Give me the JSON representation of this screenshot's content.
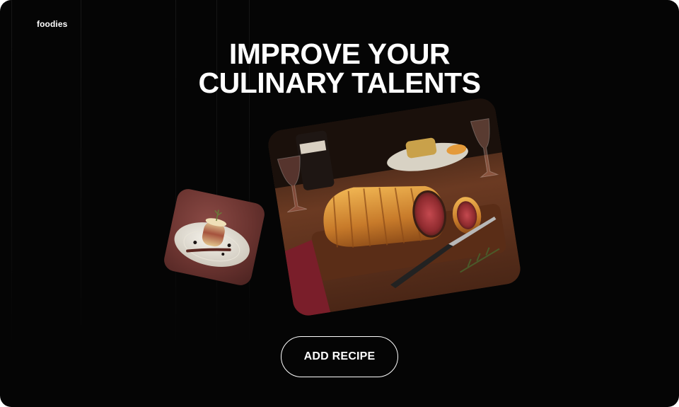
{
  "app": {
    "logo_text": "foodies"
  },
  "hero": {
    "headline_line1": "IMPROVE YOUR",
    "headline_line2": "CULINARY TALENTS"
  },
  "images": {
    "small_photo": "plated-dessert-photo",
    "large_photo": "beef-wellington-photo"
  },
  "cta": {
    "add_recipe_label": "ADD RECIPE"
  },
  "colors": {
    "background": "#050505",
    "text": "#ffffff"
  }
}
